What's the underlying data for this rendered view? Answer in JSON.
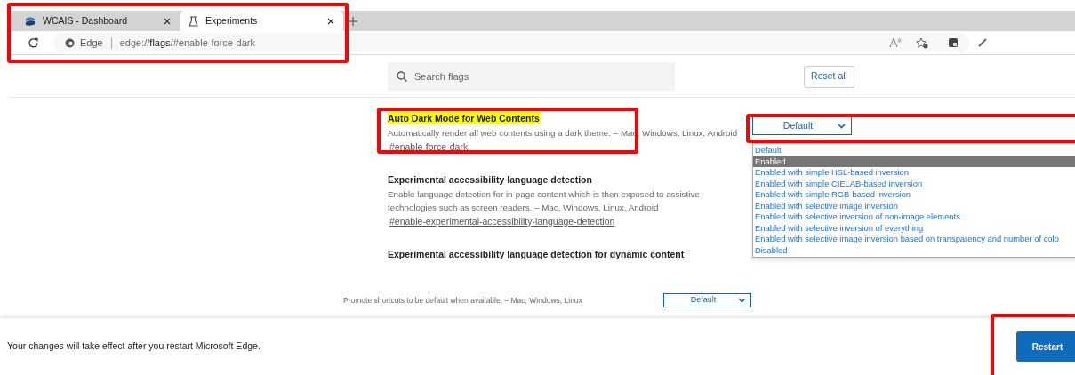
{
  "tabs": [
    {
      "title": "WCAIS - Dashboard",
      "selected": false
    },
    {
      "title": "Experiments",
      "selected": true
    }
  ],
  "address_bar": {
    "site_label": "Edge",
    "url": "edge://**flags**/#enable-force-dark"
  },
  "search": {
    "placeholder": "Search flags"
  },
  "reset_button": "Reset all",
  "flags": [
    {
      "title": "Auto Dark Mode for Web Contents",
      "highlighted": true,
      "description": "Automatically render all web contents using a dark theme. – Mac, Windows, Linux, Android",
      "anchor": "#enable-force-dark",
      "select_value": "Default"
    },
    {
      "title": "Experimental accessibility language detection",
      "highlighted": false,
      "description": "Enable language detection for in-page content which is then exposed to assistive technologies such as screen readers. – Mac, Windows, Linux, Android",
      "anchor": "#enable-experimental-accessibility-language-detection"
    },
    {
      "title": "Experimental accessibility language detection for dynamic content",
      "highlighted": false
    }
  ],
  "dropdown_options": [
    {
      "label": "Default",
      "selected": false
    },
    {
      "label": "Enabled",
      "selected": true
    },
    {
      "label": "Enabled with simple HSL-based inversion",
      "selected": false
    },
    {
      "label": "Enabled with simple CIELAB-based inversion",
      "selected": false
    },
    {
      "label": "Enabled with simple RGB-based inversion",
      "selected": false
    },
    {
      "label": "Enabled with selective image inversion",
      "selected": false
    },
    {
      "label": "Enabled with selective inversion of non-image elements",
      "selected": false
    },
    {
      "label": "Enabled with selective inversion of everything",
      "selected": false
    },
    {
      "label": "Enabled with selective image inversion based on transparency and number of colo",
      "selected": false
    },
    {
      "label": "Disabled",
      "selected": false
    }
  ],
  "partial_row": {
    "description": "Promote shortcuts to be default when available. – Mac, Windows, Linux",
    "select_value": "Default"
  },
  "footer": {
    "message": "Your changes will take effect after you restart Microsoft Edge.",
    "button": "Restart"
  }
}
